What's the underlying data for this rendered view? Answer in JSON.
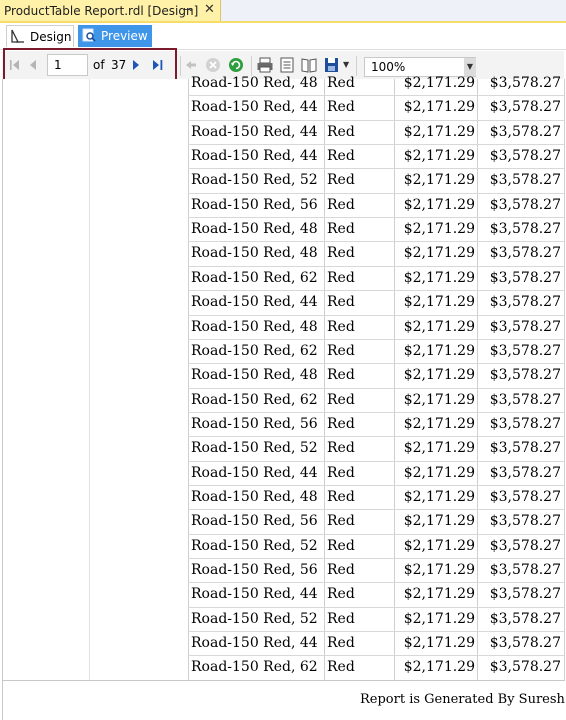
{
  "window": {
    "doc_tab_title": "ProductTable Report.rdl [Design]",
    "pin_glyph": "⊸",
    "close_glyph": "✕"
  },
  "view_tabs": {
    "design_label": "Design",
    "preview_label": "Preview",
    "active": "Preview"
  },
  "toolbar": {
    "current_page": "1",
    "of_label": "of",
    "total_pages": "37",
    "zoom": "100%"
  },
  "report": {
    "rows": [
      {
        "name": "Road-150 Red, 48",
        "color": "Red",
        "cost": "$2,171.29",
        "price": "$3,578.27"
      },
      {
        "name": "Road-150 Red, 44",
        "color": "Red",
        "cost": "$2,171.29",
        "price": "$3,578.27"
      },
      {
        "name": "Road-150 Red, 44",
        "color": "Red",
        "cost": "$2,171.29",
        "price": "$3,578.27"
      },
      {
        "name": "Road-150 Red, 44",
        "color": "Red",
        "cost": "$2,171.29",
        "price": "$3,578.27"
      },
      {
        "name": "Road-150 Red, 52",
        "color": "Red",
        "cost": "$2,171.29",
        "price": "$3,578.27"
      },
      {
        "name": "Road-150 Red, 56",
        "color": "Red",
        "cost": "$2,171.29",
        "price": "$3,578.27"
      },
      {
        "name": "Road-150 Red, 48",
        "color": "Red",
        "cost": "$2,171.29",
        "price": "$3,578.27"
      },
      {
        "name": "Road-150 Red, 48",
        "color": "Red",
        "cost": "$2,171.29",
        "price": "$3,578.27"
      },
      {
        "name": "Road-150 Red, 62",
        "color": "Red",
        "cost": "$2,171.29",
        "price": "$3,578.27"
      },
      {
        "name": "Road-150 Red, 44",
        "color": "Red",
        "cost": "$2,171.29",
        "price": "$3,578.27"
      },
      {
        "name": "Road-150 Red, 48",
        "color": "Red",
        "cost": "$2,171.29",
        "price": "$3,578.27"
      },
      {
        "name": "Road-150 Red, 62",
        "color": "Red",
        "cost": "$2,171.29",
        "price": "$3,578.27"
      },
      {
        "name": "Road-150 Red, 48",
        "color": "Red",
        "cost": "$2,171.29",
        "price": "$3,578.27"
      },
      {
        "name": "Road-150 Red, 62",
        "color": "Red",
        "cost": "$2,171.29",
        "price": "$3,578.27"
      },
      {
        "name": "Road-150 Red, 56",
        "color": "Red",
        "cost": "$2,171.29",
        "price": "$3,578.27"
      },
      {
        "name": "Road-150 Red, 52",
        "color": "Red",
        "cost": "$2,171.29",
        "price": "$3,578.27"
      },
      {
        "name": "Road-150 Red, 44",
        "color": "Red",
        "cost": "$2,171.29",
        "price": "$3,578.27"
      },
      {
        "name": "Road-150 Red, 48",
        "color": "Red",
        "cost": "$2,171.29",
        "price": "$3,578.27"
      },
      {
        "name": "Road-150 Red, 56",
        "color": "Red",
        "cost": "$2,171.29",
        "price": "$3,578.27"
      },
      {
        "name": "Road-150 Red, 52",
        "color": "Red",
        "cost": "$2,171.29",
        "price": "$3,578.27"
      },
      {
        "name": "Road-150 Red, 56",
        "color": "Red",
        "cost": "$2,171.29",
        "price": "$3,578.27"
      },
      {
        "name": "Road-150 Red, 44",
        "color": "Red",
        "cost": "$2,171.29",
        "price": "$3,578.27"
      },
      {
        "name": "Road-150 Red, 52",
        "color": "Red",
        "cost": "$2,171.29",
        "price": "$3,578.27"
      },
      {
        "name": "Road-150 Red, 44",
        "color": "Red",
        "cost": "$2,171.29",
        "price": "$3,578.27"
      },
      {
        "name": "Road-150 Red, 62",
        "color": "Red",
        "cost": "$2,171.29",
        "price": "$3,578.27"
      }
    ],
    "footer": "Report is Generated By Suresh"
  },
  "colors": {
    "doc_tab": "#fff1a8",
    "preview_tab": "#3f96e8",
    "nav_highlight": "#7a1a2a"
  },
  "icons": [
    "pin-icon",
    "close-icon",
    "design-icon",
    "preview-icon",
    "first-page-icon",
    "previous-page-icon",
    "next-page-icon",
    "last-page-icon",
    "back-icon",
    "stop-icon",
    "refresh-icon",
    "print-icon",
    "print-layout-icon",
    "page-setup-icon",
    "export-icon",
    "chevron-down-icon"
  ]
}
